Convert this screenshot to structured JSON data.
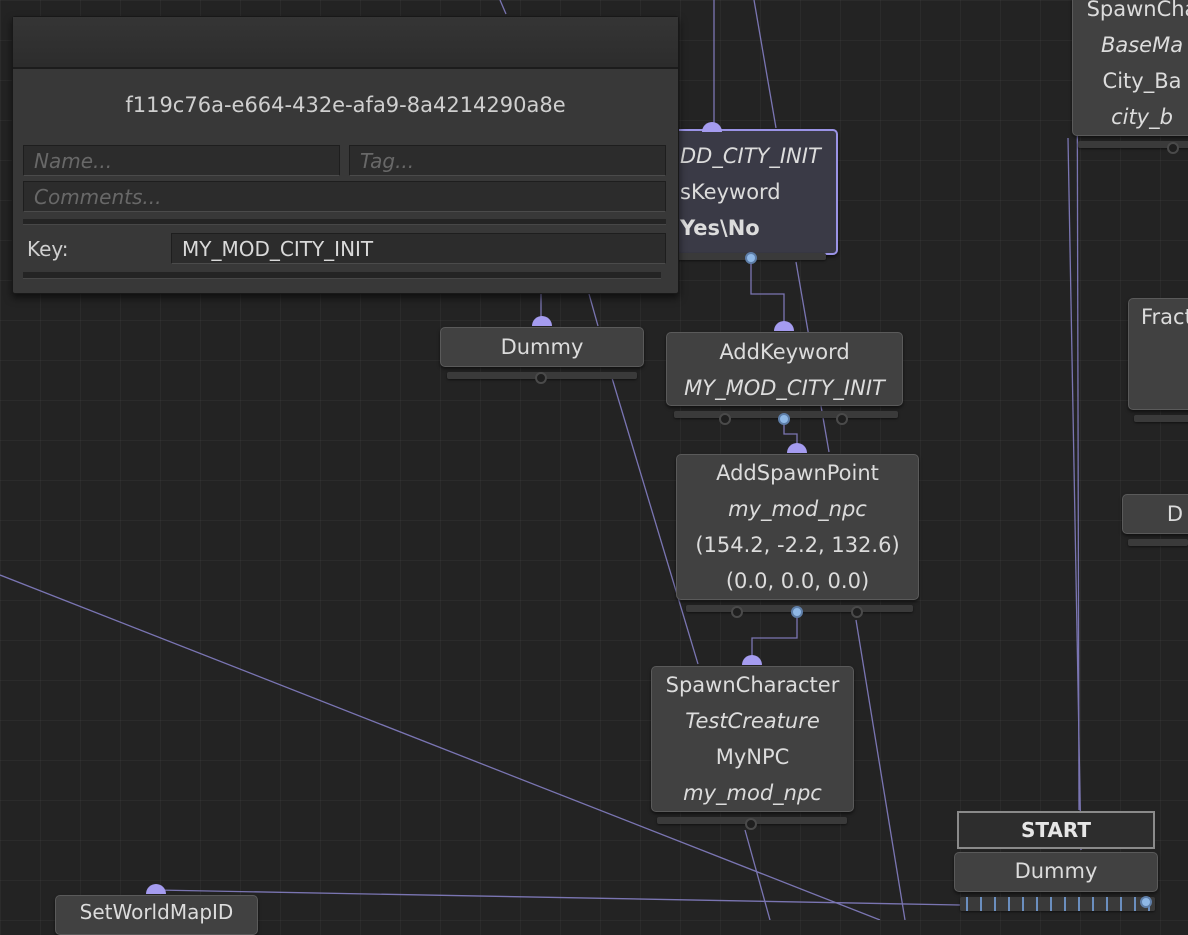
{
  "inspector": {
    "guid": "f119c76a-e664-432e-afa9-8a4214290a8e",
    "name_placeholder": "Name...",
    "tag_placeholder": "Tag...",
    "comments_placeholder": "Comments...",
    "key_label": "Key:",
    "key_value": "MY_MOD_CITY_INIT"
  },
  "nodes": {
    "selected": {
      "line1": "DD_CITY_INIT",
      "line2": "sKeyword",
      "line3": "Yes\\No"
    },
    "dummy1": {
      "title": "Dummy"
    },
    "add_keyword": {
      "title": "AddKeyword",
      "line1": "MY_MOD_CITY_INIT"
    },
    "add_spawn_point": {
      "title": "AddSpawnPoint",
      "line1": "my_mod_npc",
      "line2": "(154.2, -2.2, 132.6)",
      "line3": "(0.0, 0.0, 0.0)"
    },
    "spawn_character": {
      "title": "SpawnCharacter",
      "line1": "TestCreature",
      "line2": "MyNPC",
      "line3": "my_mod_npc"
    },
    "top_right": {
      "title": "SpawnCha",
      "line1": "BaseMa",
      "line2": "City_Ba",
      "line3": "city_b"
    },
    "fraction": {
      "title": "Fract"
    },
    "right_small": {
      "title": "D"
    },
    "start": {
      "label": "START"
    },
    "dummy_start": {
      "title": "Dummy"
    },
    "set_world": {
      "title": "SetWorldMapID"
    }
  },
  "colors": {
    "wire": "#8a84cc",
    "port_in": "#a59cf0",
    "port_active": "#8fb8e6",
    "selection": "#9a93e6"
  }
}
